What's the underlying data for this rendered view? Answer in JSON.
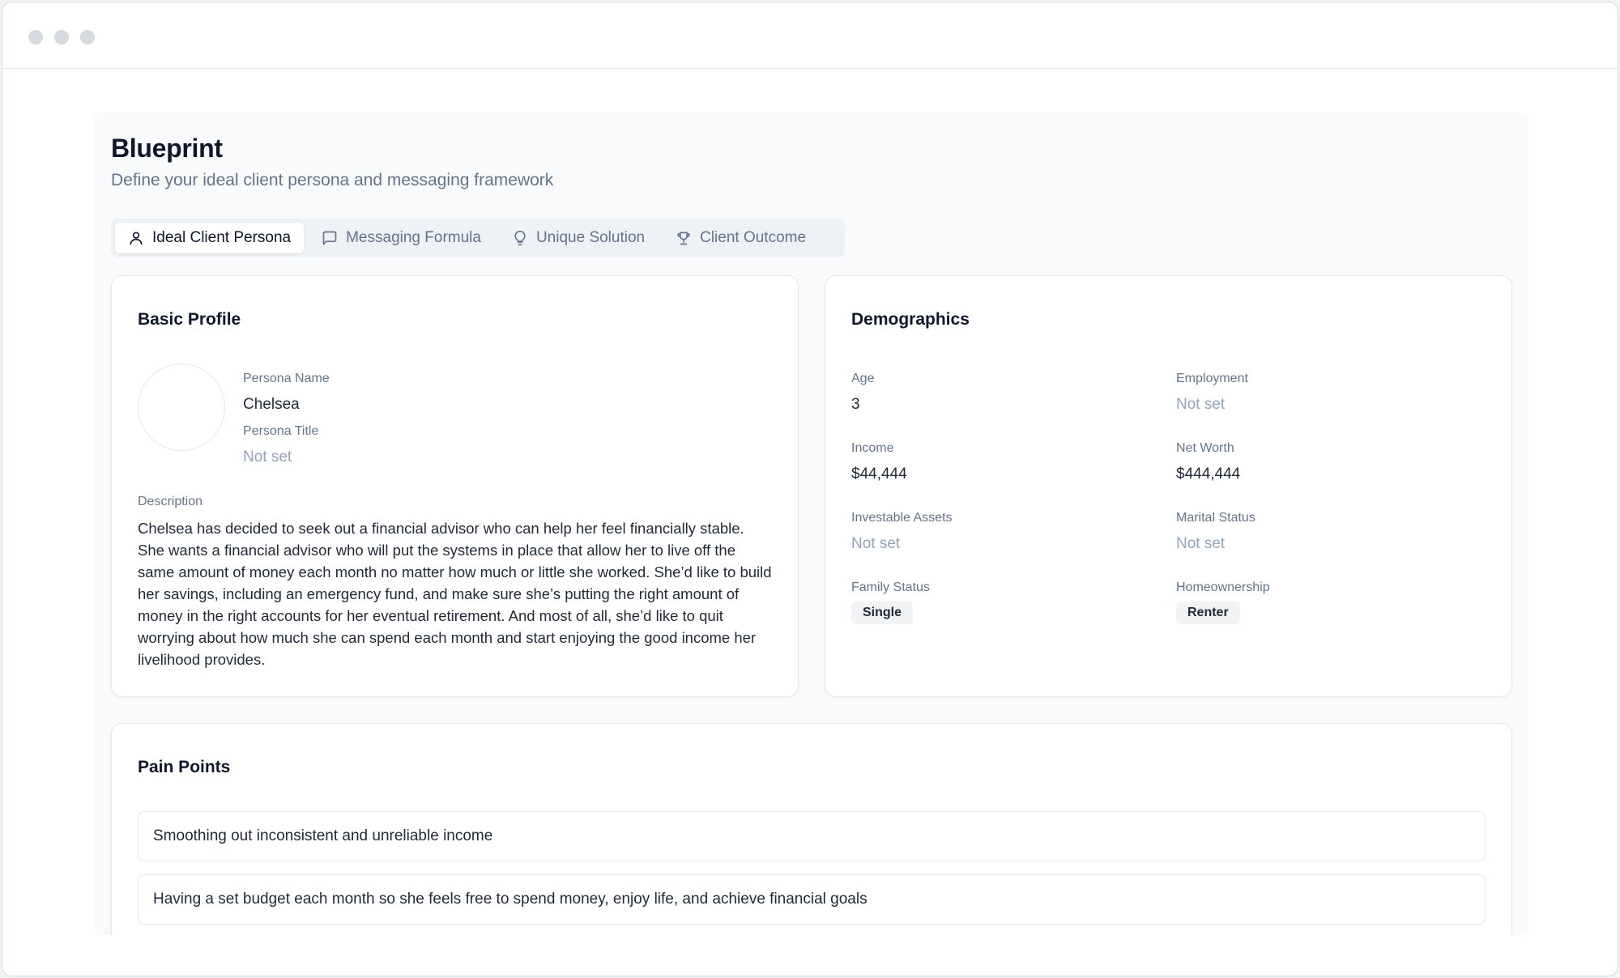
{
  "page": {
    "title": "Blueprint",
    "subtitle": "Define your ideal client persona and messaging framework"
  },
  "tabs": [
    {
      "label": "Ideal Client Persona",
      "icon": "user-icon",
      "active": true
    },
    {
      "label": "Messaging Formula",
      "icon": "message-square-icon",
      "active": false
    },
    {
      "label": "Unique Solution",
      "icon": "lightbulb-icon",
      "active": false
    },
    {
      "label": "Client Outcome",
      "icon": "trophy-icon",
      "active": false
    }
  ],
  "basic_profile": {
    "title": "Basic Profile",
    "persona_name_label": "Persona Name",
    "persona_name": "Chelsea",
    "persona_title_label": "Persona Title",
    "persona_title": "Not set",
    "description_label": "Description",
    "description": "Chelsea has decided to seek out a financial advisor who can help her feel financially stable. She wants a financial advisor who will put the systems in place that allow her to live off the same amount of money each month no matter how much or little she worked. She’d like to build her savings, including an emergency fund, and make sure she’s putting the right amount of money in the right accounts for her eventual retirement. And most of all, she’d like to quit worrying about how much she can spend each month and start enjoying the good income her livelihood provides."
  },
  "demographics": {
    "title": "Demographics",
    "age_label": "Age",
    "age": "3",
    "employment_label": "Employment",
    "employment": "Not set",
    "income_label": "Income",
    "income": "$44,444",
    "net_worth_label": "Net Worth",
    "net_worth": "$444,444",
    "investable_assets_label": "Investable Assets",
    "investable_assets": "Not set",
    "marital_status_label": "Marital Status",
    "marital_status": "Not set",
    "family_status_label": "Family Status",
    "family_status": "Single",
    "homeownership_label": "Homeownership",
    "homeownership": "Renter"
  },
  "pain_points": {
    "title": "Pain Points",
    "items": [
      "Smoothing out inconsistent and unreliable income",
      "Having a set budget each month so she feels free to spend money, enjoy life, and achieve financial goals"
    ]
  }
}
